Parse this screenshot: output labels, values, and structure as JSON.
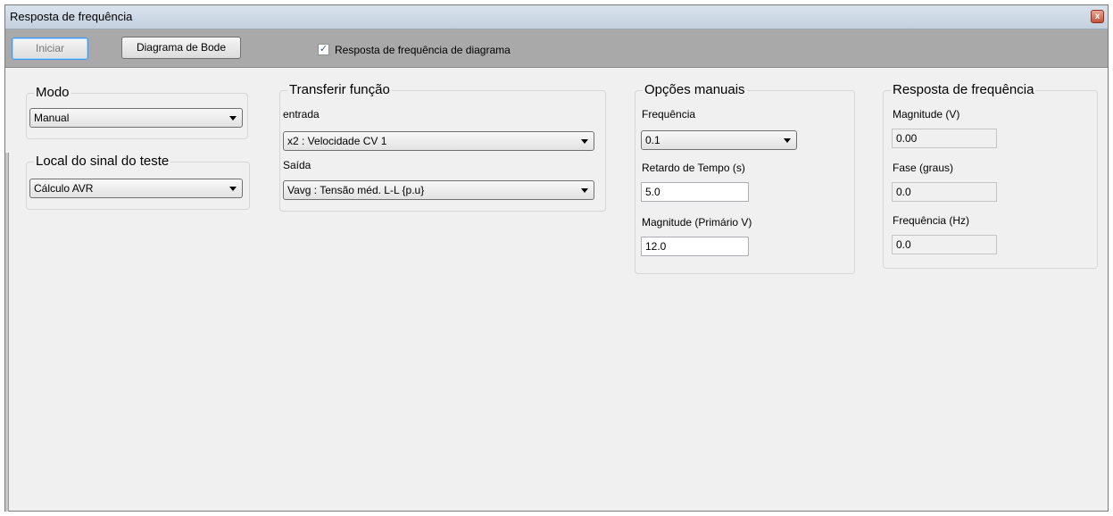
{
  "window": {
    "title": "Resposta de frequência",
    "close_glyph": "x"
  },
  "toolbar": {
    "start_label": "Iniciar",
    "bode_label": "Diagrama de Bode",
    "plot_checkbox_label": "Resposta de frequência de diagrama",
    "plot_checkbox_checked": true,
    "check_glyph": "✓"
  },
  "modo": {
    "title": "Modo",
    "value": "Manual"
  },
  "local": {
    "title": "Local do sinal do teste",
    "value": "Cálculo AVR"
  },
  "transfer": {
    "title": "Transferir função",
    "input_label": "entrada",
    "input_value": "x2 : Velocidade CV 1",
    "output_label": "Saída",
    "output_value": "Vavg : Tensão méd. L-L {p.u}"
  },
  "manual": {
    "title": "Opções manuais",
    "freq_label": "Frequência",
    "freq_value": "0.1",
    "delay_label": "Retardo de Tempo (s)",
    "delay_value": "5.0",
    "mag_label": "Magnitude (Primário V)",
    "mag_value": "12.0"
  },
  "response": {
    "title": "Resposta de frequência",
    "mag_label": "Magnitude (V)",
    "mag_value": "0.00",
    "phase_label": "Fase (graus)",
    "phase_value": "0.0",
    "freq_label": "Frequência (Hz)",
    "freq_value": "0.0"
  },
  "colors": {
    "toolbar": "#a9a9a9",
    "window_bg": "#f0f0f0",
    "close": "#c2553b"
  }
}
